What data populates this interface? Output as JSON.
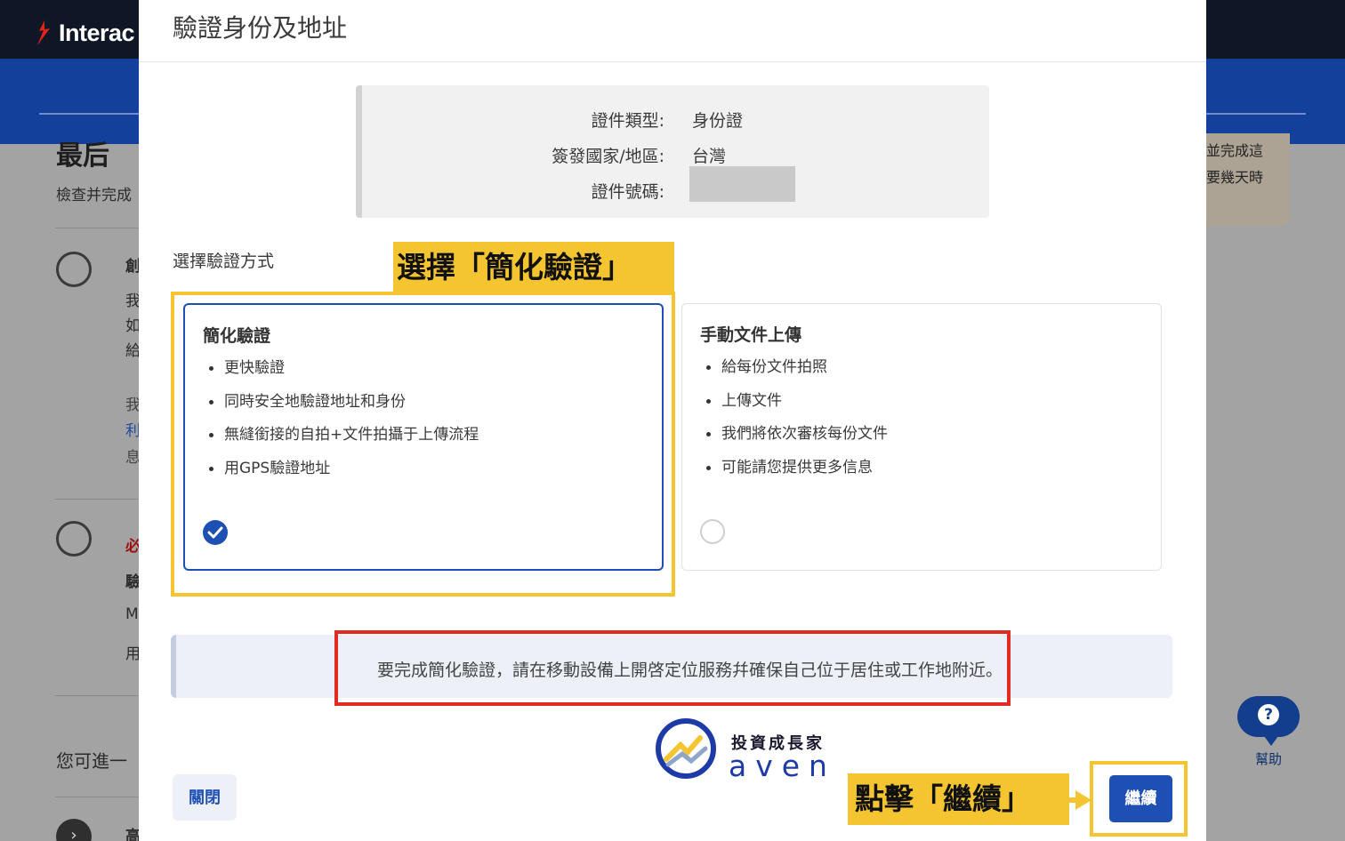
{
  "background": {
    "brand": "Interac",
    "heading_fragment": "最后",
    "subtitle_fragment": "檢查并完成",
    "item1_letter": "創",
    "item1_lines": [
      "我",
      "如",
      "給"
    ],
    "item1_extra": [
      "我",
      "利",
      "息"
    ],
    "item2_letter": "必",
    "item2_line_a": "驗",
    "item2_line_b": "M",
    "item2_line_c": "用",
    "more_text": "您可進一",
    "more_third": "高",
    "right_card_lines": [
      "並完成這",
      "要幾天時"
    ],
    "help_label": "幫助",
    "help_symbol": "?"
  },
  "modal": {
    "title": "驗證身份及地址",
    "details": [
      {
        "label": "證件類型:",
        "value": "身份證"
      },
      {
        "label": "簽發國家/地區:",
        "value": "台灣"
      },
      {
        "label": "證件號碼:",
        "value": ""
      }
    ],
    "method_label": "選擇驗證方式",
    "options": [
      {
        "title": "簡化驗證",
        "bullets": [
          "更快驗證",
          "同時安全地驗證地址和身份",
          "無縫銜接的自拍+文件拍攝于上傳流程",
          "用GPS驗證地址"
        ],
        "selected": true
      },
      {
        "title": "手動文件上傳",
        "bullets": [
          "給每份文件拍照",
          "上傳文件",
          "我們將依次審核每份文件",
          "可能請您提供更多信息"
        ],
        "selected": false
      }
    ],
    "notice": "要完成簡化驗證，請在移動設備上開啓定位服務幷確保自己位于居住或工作地附近。",
    "close_label": "關閉",
    "continue_label": "繼續"
  },
  "annotations": {
    "callout_select": "選擇「簡化驗證」",
    "callout_continue": "點擊「繼續」"
  },
  "watermark": {
    "top": "投資成長家",
    "bottom": "aven"
  },
  "colors": {
    "primary": "#1e4fb3",
    "highlight_yellow": "#f4c531",
    "highlight_red": "#e02b22",
    "topbar": "#0f1626",
    "header_band": "#12409a"
  }
}
